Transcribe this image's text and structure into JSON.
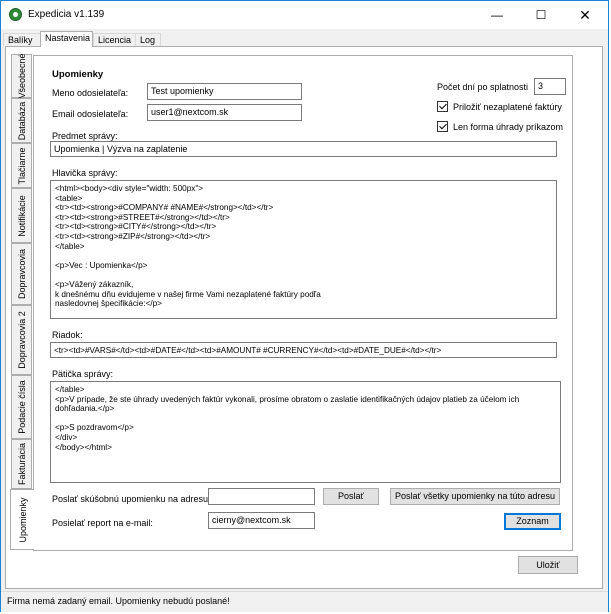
{
  "window": {
    "title": "Expedicia v1.139",
    "minimize": "—",
    "maximize": "☐",
    "close": "✕"
  },
  "tabs": [
    "Balíky",
    "Nastavenia",
    "Licencia",
    "Log"
  ],
  "side_tabs": [
    "Všeobecné",
    "Databáza",
    "Tlačiarne",
    "Notifikácie",
    "Dopravcovia",
    "Dopravcovia 2",
    "Podacie čísla",
    "Fakturácia",
    "Upomienky"
  ],
  "section_title": "Upomienky",
  "sender_name": {
    "label": "Meno odosielateľa:",
    "value": "Test upomienky"
  },
  "sender_email": {
    "label": "Email odosielateľa:",
    "value": "user1@nextcom.sk"
  },
  "days_after_due": {
    "label": "Počet dní po splatnosti",
    "value": "3"
  },
  "attach_unpaid": {
    "label": "Priložiť nezaplatené faktúry",
    "checked": true
  },
  "order_payment_only": {
    "label": "Len forma úhrady príkazom",
    "checked": true
  },
  "subject": {
    "label": "Predmet správy:",
    "value": "Upomienka |  Výzva na zaplatenie"
  },
  "header": {
    "label": "Hlavička správy:",
    "value": "<html><body><div style=\"width: 500px\">\n<table>\n<tr><td><strong>#COMPANY# #NAME#</strong></td></tr>\n<tr><td><strong>#STREET#</strong></td></tr>\n<tr><td><strong>#CITY#</strong></td></tr>\n<tr><td><strong>#ZIP#</strong></td></tr>\n</table>\n\n<p>Vec : Upomienka</p>\n\n<p>Vážený zákazník,\nk dnešnému dňu evidujeme v našej firme Vami nezaplatené faktúry podľa\nnasledovnej špecifikácie:</p>"
  },
  "row": {
    "label": "Riadok:",
    "value": "<tr><td>#VARS#</td><td>#DATE#</td><td>#AMOUNT# #CURRENCY#</td><td>#DATE_DUE#</td></tr>"
  },
  "footer": {
    "label": "Pätička správy:",
    "value": "</table>\n<p>V prípade, že ste úhrady uvedených faktúr vykonali, prosíme obratom o zaslatie identifikačných údajov platieb za účelom ich\ndohľadania.</p>\n\n<p>S pozdravom</p>\n</div>\n</body></html>"
  },
  "test_send": {
    "label": "Poslať skúšobnú upomienku na adresu:",
    "value": "",
    "send_button": "Poslať",
    "send_all_button": "Poslať všetky upomienky na túto adresu"
  },
  "report": {
    "label": "Posielať report na e-mail:",
    "value": "cierny@nextcom.sk",
    "list_button": "Zoznam"
  },
  "save_button": "Uložiť",
  "status": "Firma  nemá zadaný email. Upomienky nebudú poslané!"
}
